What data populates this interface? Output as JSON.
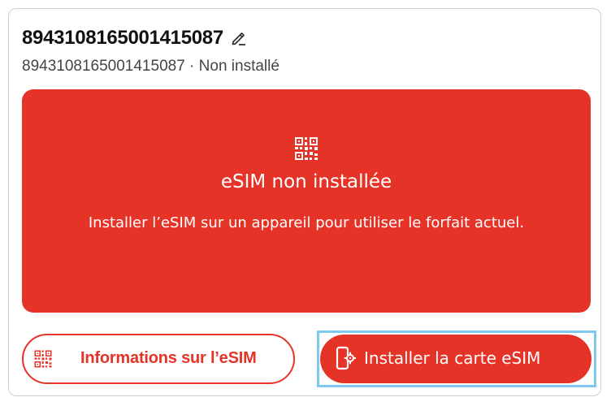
{
  "sim": {
    "title": "8943108165001415087",
    "subtitle": "8943108165001415087 · Non installé"
  },
  "banner": {
    "icon": "qr-code-icon",
    "heading": "eSIM non installée",
    "message": "Installer l’eSIM sur un appareil pour utiliser le forfait actuel."
  },
  "actions": {
    "info_label": "Informations sur l’eSIM",
    "info_icon": "qr-code-icon",
    "install_label": "Installer la carte eSIM",
    "install_icon": "phone-settings-icon"
  },
  "colors": {
    "accent": "#e63327",
    "focus": "#7ec8ef"
  },
  "edit_icon": "pencil-icon"
}
